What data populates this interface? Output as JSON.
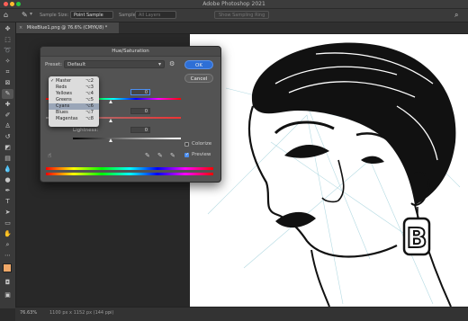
{
  "app": {
    "title": "Adobe Photoshop 2021"
  },
  "options": {
    "sample_size_label": "Sample Size:",
    "sample_size_value": "Point Sample",
    "sample_label": "Sample:",
    "sample_value": "All Layers",
    "show_ring": "Show Sampling Ring"
  },
  "document": {
    "tab_label": "MikeBlue1.png @ 76.6% (CMYK/8) *"
  },
  "status": {
    "zoom": "76.63%",
    "doc_info": "1100 px x 1152 px (144 ppi)"
  },
  "dialog": {
    "title": "Hue/Saturation",
    "preset_label": "Preset:",
    "preset_value": "Default",
    "ok_label": "OK",
    "cancel_label": "Cancel",
    "hue_value": "0",
    "saturation_value": "0",
    "lightness_label": "Lightness:",
    "lightness_value": "0",
    "colorize_label": "Colorize",
    "preview_label": "Preview",
    "preview_checked": true,
    "colorize_checked": false
  },
  "channel_menu": {
    "items": [
      {
        "label": "Master",
        "shortcut": "⌥2",
        "checked": "✓"
      },
      {
        "label": "Reds",
        "shortcut": "⌥3",
        "checked": ""
      },
      {
        "label": "Yellows",
        "shortcut": "⌥4",
        "checked": ""
      },
      {
        "label": "Greens",
        "shortcut": "⌥5",
        "checked": ""
      },
      {
        "label": "Cyans",
        "shortcut": "⌥6",
        "checked": ""
      },
      {
        "label": "Blues",
        "shortcut": "⌥7",
        "checked": ""
      },
      {
        "label": "Magentas",
        "shortcut": "⌥8",
        "checked": ""
      }
    ],
    "highlighted_label": "Cyans"
  },
  "earring_text": "B",
  "colors": {
    "accent_blue": "#4b8ef0",
    "menu_highlight": "#9aa6b8",
    "fg_swatch": "#f0a868",
    "bg_swatch": "#ffffff"
  }
}
